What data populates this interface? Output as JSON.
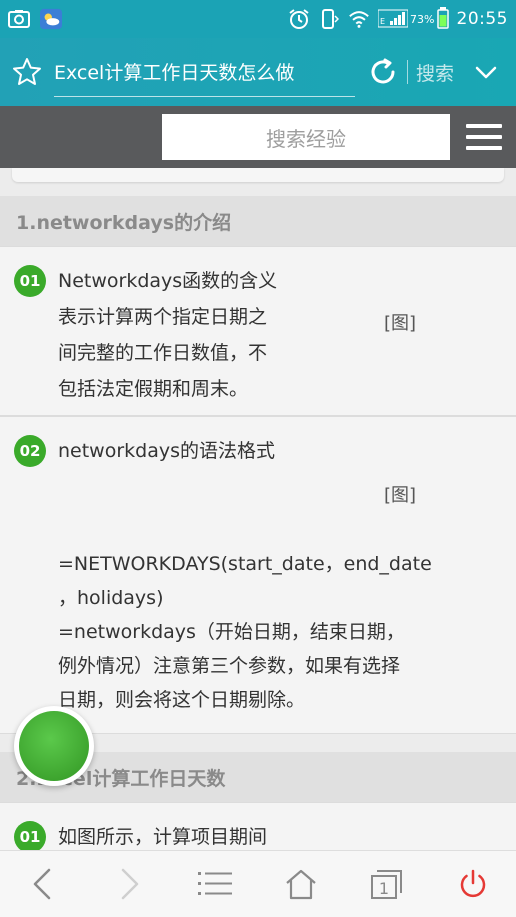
{
  "status_bar": {
    "battery_percent": "73%",
    "time": "20:55",
    "icons": [
      "screenshot-icon",
      "weather-icon",
      "alarm-icon",
      "phone-vibrate-icon",
      "wifi-icon",
      "signal-icon",
      "battery-icon"
    ]
  },
  "header": {
    "title": "Excel计算工作日天数怎么做",
    "search_label": "搜索"
  },
  "search_bar": {
    "placeholder": "搜索经验"
  },
  "sections": [
    {
      "heading": "1.networkdays的介绍",
      "steps": [
        {
          "number": "01",
          "lines": [
            "Networkdays函数的含义",
            "表示计算两个指定日期之",
            "间完整的工作日数值，不",
            "包括法定假期和周末。"
          ],
          "image_placeholder": "[图]"
        },
        {
          "number": "02",
          "lines": [
            "networkdays的语法格式"
          ],
          "image_placeholder": "[图]",
          "extra_lines": [
            "=NETWORKDAYS(start_date，end_date",
            "，holidays)",
            "=networkdays（开始日期，结束日期，",
            "例外情况）注意第三个参数，如果有选择",
            "日期，则会将这个日期剔除。"
          ]
        }
      ]
    },
    {
      "heading": "2.Excel计算工作日天数",
      "steps": [
        {
          "number": "01",
          "lines": [
            "如图所示，计算项目期间"
          ]
        }
      ]
    }
  ],
  "colors": {
    "header_teal": "#1ba3b5",
    "badge_green": "#3aaa2a",
    "power_red": "#e53935"
  },
  "bottom_nav": [
    "back-icon",
    "forward-icon",
    "menu-icon",
    "home-icon",
    "tabs-icon",
    "power-icon"
  ],
  "tab_count": "1"
}
